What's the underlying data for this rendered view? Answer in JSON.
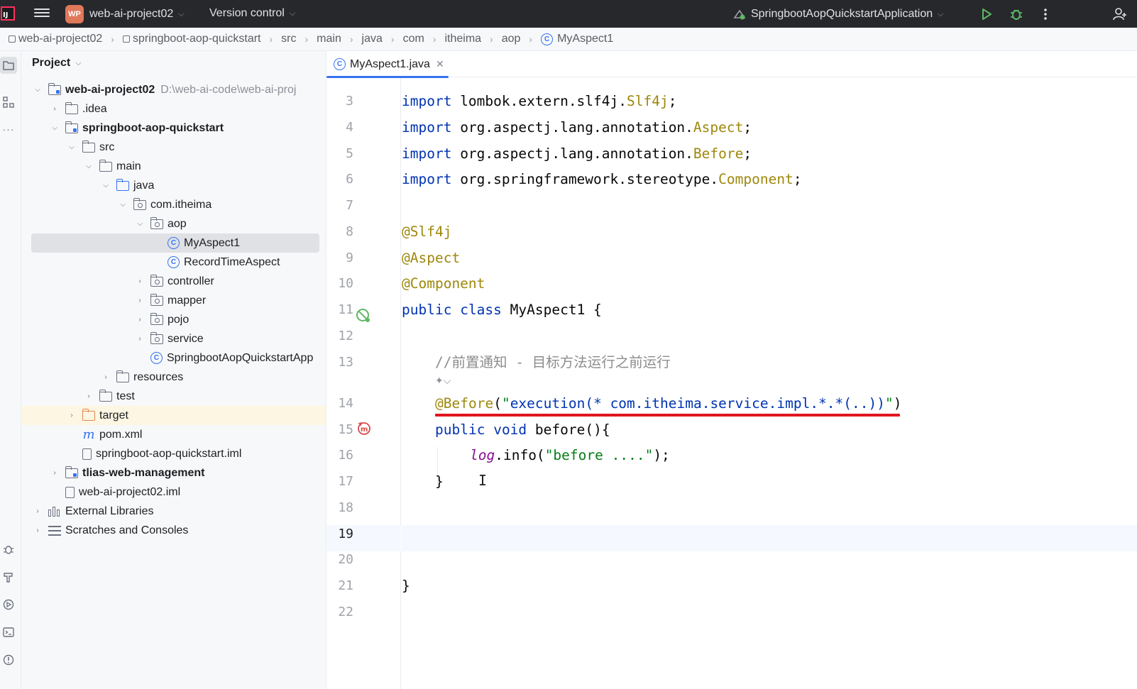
{
  "titlebar": {
    "project_badge": "WP",
    "project_name": "web-ai-project02",
    "vcs_label": "Version control",
    "run_config": "SpringbootAopQuickstartApplication"
  },
  "breadcrumb": [
    "web-ai-project02",
    "springboot-aop-quickstart",
    "src",
    "main",
    "java",
    "com",
    "itheima",
    "aop",
    "MyAspect1"
  ],
  "project_panel": {
    "header": "Project",
    "tree": [
      {
        "label": "web-ai-project02",
        "extra": "D:\\web-ai-code\\web-ai-proj"
      },
      {
        "label": ".idea"
      },
      {
        "label": "springboot-aop-quickstart"
      },
      {
        "label": "src"
      },
      {
        "label": "main"
      },
      {
        "label": "java"
      },
      {
        "label": "com.itheima"
      },
      {
        "label": "aop"
      },
      {
        "label": "MyAspect1"
      },
      {
        "label": "RecordTimeAspect"
      },
      {
        "label": "controller"
      },
      {
        "label": "mapper"
      },
      {
        "label": "pojo"
      },
      {
        "label": "service"
      },
      {
        "label": "SpringbootAopQuickstartApp"
      },
      {
        "label": "resources"
      },
      {
        "label": "test"
      },
      {
        "label": "target"
      },
      {
        "label": "pom.xml"
      },
      {
        "label": "springboot-aop-quickstart.iml"
      },
      {
        "label": "tlias-web-management"
      },
      {
        "label": "web-ai-project02.iml"
      },
      {
        "label": "External Libraries"
      },
      {
        "label": "Scratches and Consoles"
      }
    ]
  },
  "editor": {
    "tab_label": "MyAspect1.java",
    "line_numbers": [
      "3",
      "4",
      "5",
      "6",
      "7",
      "8",
      "9",
      "10",
      "11",
      "12",
      "13",
      "14",
      "15",
      "16",
      "17",
      "18",
      "19",
      "20",
      "21",
      "22"
    ],
    "code": {
      "l3": {
        "kw": "import",
        "pkg": " lombok.extern.slf4j.",
        "cls": "Slf4j",
        "end": ";"
      },
      "l4": {
        "kw": "import",
        "pkg": " org.aspectj.lang.annotation.",
        "cls": "Aspect",
        "end": ";"
      },
      "l5": {
        "kw": "import",
        "pkg": " org.aspectj.lang.annotation.",
        "cls": "Before",
        "end": ";"
      },
      "l6": {
        "kw": "import",
        "pkg": " org.springframework.stereotype.",
        "cls": "Component",
        "end": ";"
      },
      "l8": "@Slf4j",
      "l9": "@Aspect",
      "l10": "@Component",
      "l11": {
        "kw1": "public",
        "kw2": "class",
        "rest": " MyAspect1 {"
      },
      "l13": "//前置通知 - 目标方法运行之前运行",
      "l14": {
        "ann": "@Before",
        "open": "(",
        "q1": "\"",
        "str": "execution(* com.itheima.service.impl.*.*(..))",
        "q2": "\"",
        "close": ")"
      },
      "l15": {
        "kw1": "public",
        "kw2": "void",
        "rest": " before(){"
      },
      "l16": {
        "fld": "log",
        "rest": ".info(",
        "str": "\"before ....\"",
        "end": ");"
      },
      "l17": "}",
      "l21": "}"
    }
  }
}
